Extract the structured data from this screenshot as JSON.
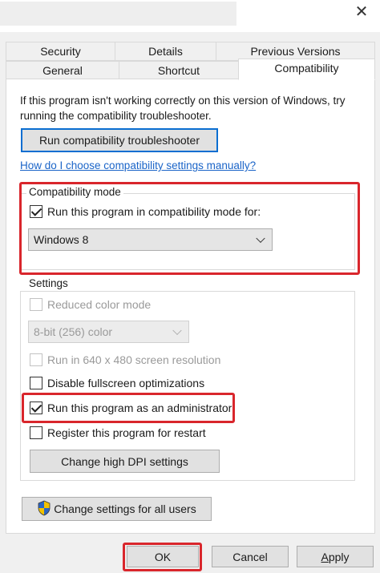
{
  "window": {
    "close_glyph": "✕"
  },
  "tabs": {
    "row1": [
      "Security",
      "Details",
      "Previous Versions"
    ],
    "row2": [
      "General",
      "Shortcut",
      "Compatibility"
    ],
    "active": "Compatibility"
  },
  "intro_text": "If this program isn't working correctly on this version of Windows, try running the compatibility troubleshooter.",
  "troubleshooter_button": "Run compatibility troubleshooter",
  "help_link": "How do I choose compatibility settings manually?",
  "compat_mode": {
    "legend": "Compatibility mode",
    "checkbox_label": "Run this program in compatibility mode for:",
    "checked": true,
    "selected_os": "Windows 8"
  },
  "settings": {
    "legend": "Settings",
    "reduced_color": {
      "label": "Reduced color mode",
      "checked": false,
      "enabled": false
    },
    "color_select": "8-bit (256) color",
    "resolution": {
      "label": "Run in 640 x 480 screen resolution",
      "checked": false,
      "enabled": false
    },
    "fullscreen": {
      "label": "Disable fullscreen optimizations",
      "checked": false,
      "enabled": true
    },
    "admin": {
      "label": "Run this program as an administrator",
      "checked": true,
      "enabled": true
    },
    "restart": {
      "label": "Register this program for restart",
      "checked": false,
      "enabled": true
    },
    "dpi_button": "Change high DPI settings"
  },
  "all_users_button": "Change settings for all users",
  "footer": {
    "ok": "OK",
    "cancel": "Cancel",
    "apply": "Apply"
  },
  "colors": {
    "highlight": "#d9262c",
    "link": "#1a64c8",
    "focus": "#0a6ed1"
  },
  "icons": {
    "uac": "uac-shield-icon",
    "close": "close-icon",
    "dropdown": "chevron-down-icon"
  }
}
